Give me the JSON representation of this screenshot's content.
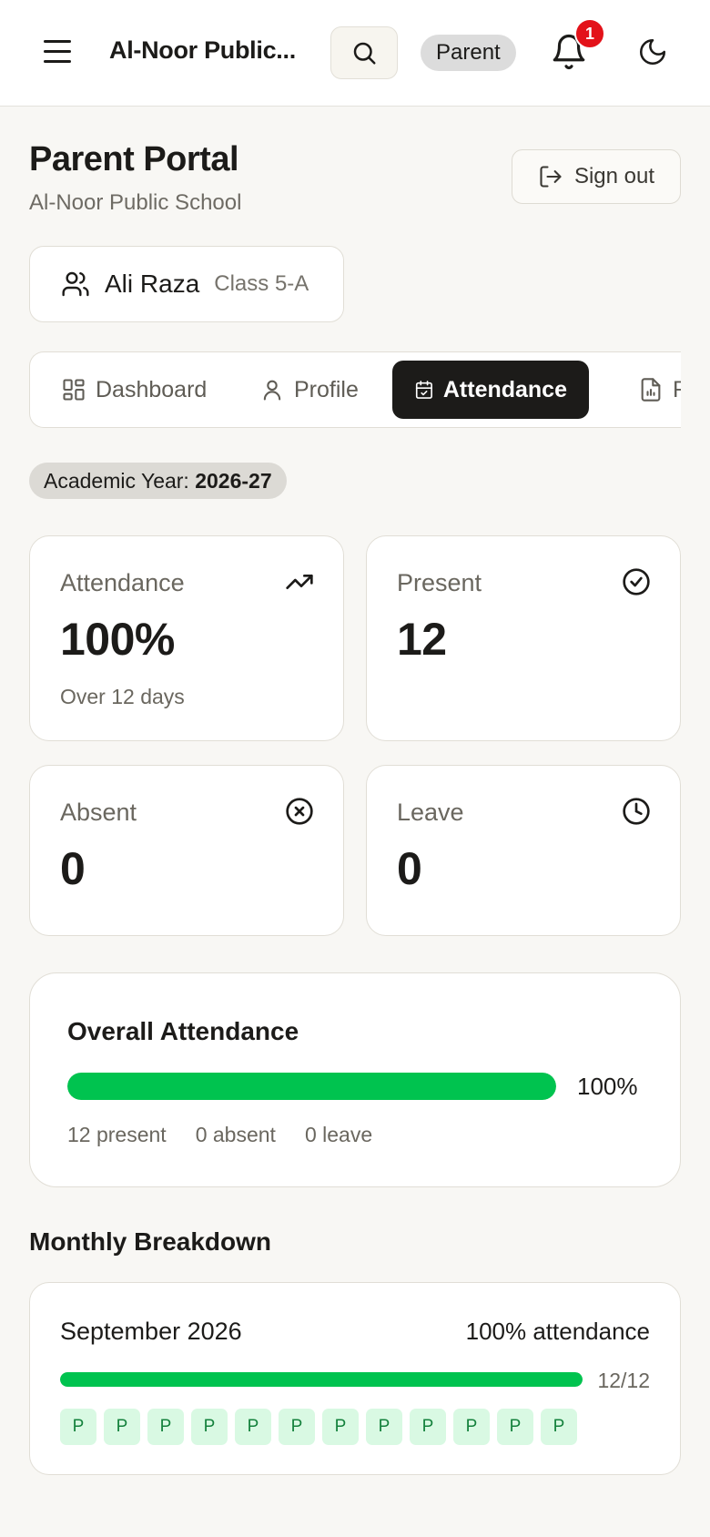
{
  "header": {
    "app_title": "Al-Noor Public...",
    "role_badge": "Parent",
    "notification_count": "1"
  },
  "portal": {
    "title": "Parent Portal",
    "subtitle": "Al-Noor Public School",
    "signout_label": "Sign out"
  },
  "student": {
    "name": "Ali Raza",
    "class": "Class 5-A"
  },
  "tabs": [
    {
      "label": "Dashboard",
      "icon": "dashboard-icon",
      "active": false
    },
    {
      "label": "Profile",
      "icon": "user-icon",
      "active": false
    },
    {
      "label": "Attendance",
      "icon": "calendar-check-icon",
      "active": true
    },
    {
      "label": "Re",
      "icon": "report-icon",
      "active": false
    }
  ],
  "academic_year": {
    "label": "Academic Year:",
    "value": "2026-27"
  },
  "stats": {
    "attendance": {
      "label": "Attendance",
      "value": "100%",
      "note": "Over 12 days",
      "icon": "trending-up-icon"
    },
    "present": {
      "label": "Present",
      "value": "12",
      "icon": "check-circle-icon"
    },
    "absent": {
      "label": "Absent",
      "value": "0",
      "icon": "x-circle-icon"
    },
    "leave": {
      "label": "Leave",
      "value": "0",
      "icon": "clock-icon"
    }
  },
  "overall": {
    "title": "Overall Attendance",
    "percent_label": "100%",
    "percent": 100,
    "present_text": "12 present",
    "absent_text": "0 absent",
    "leave_text": "0 leave"
  },
  "monthly": {
    "heading": "Monthly Breakdown",
    "months": [
      {
        "name": "September 2026",
        "attendance_label": "100% attendance",
        "ratio": "12/12",
        "percent": 100,
        "days": [
          "P",
          "P",
          "P",
          "P",
          "P",
          "P",
          "P",
          "P",
          "P",
          "P",
          "P",
          "P"
        ]
      }
    ]
  },
  "colors": {
    "accent_green": "#00c34f",
    "badge_red": "#e3121a",
    "active_tab": "#1c1b19",
    "day_bg": "#d9f9e3",
    "day_text": "#14813c"
  }
}
